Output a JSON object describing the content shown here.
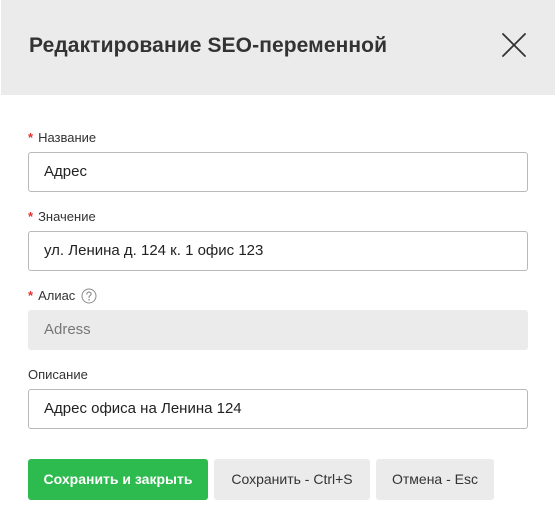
{
  "dialog": {
    "title": "Редактирование SEO-переменной"
  },
  "fields": {
    "name": {
      "required_mark": "*",
      "label": "Название",
      "value": "Адрес"
    },
    "value": {
      "required_mark": "*",
      "label": "Значение",
      "value": "ул. Ленина д. 124 к. 1 офис 123"
    },
    "alias": {
      "required_mark": "*",
      "label": "Алиас",
      "value": "Adress",
      "disabled": true
    },
    "description": {
      "label": "Описание",
      "value": "Адрес офиса на Ленина 124"
    }
  },
  "buttons": {
    "save_close": "Сохранить и закрыть",
    "save": "Сохранить - Ctrl+S",
    "cancel": "Отмена - Esc"
  },
  "colors": {
    "primary": "#2dba4e",
    "required": "#e0332f",
    "header_bg": "#ebebeb"
  },
  "icons": {
    "close": "close-icon",
    "help": "help-icon"
  }
}
